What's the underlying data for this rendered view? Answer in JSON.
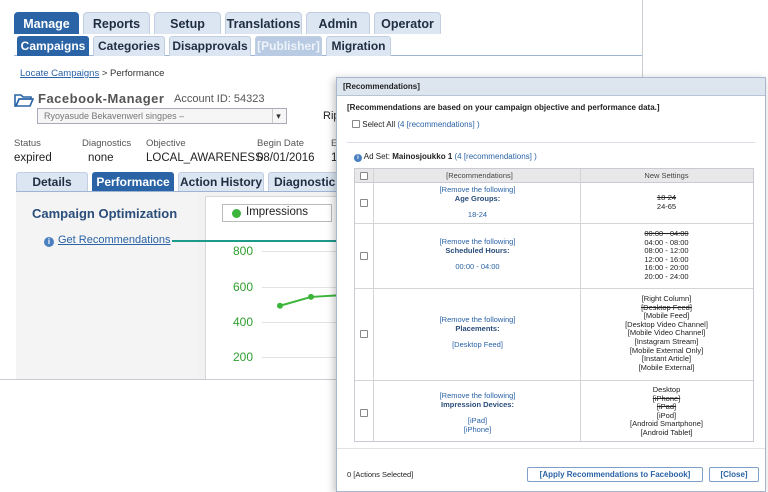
{
  "main_tabs": [
    "Manage",
    "Reports",
    "Setup",
    "Translations",
    "Admin",
    "Operator"
  ],
  "sub_tabs": [
    "Campaigns",
    "Categories",
    "Disapprovals",
    "[Publisher]",
    "Migration"
  ],
  "breadcrumb": {
    "link": "Locate Campaigns",
    "sep": " > ",
    "current": "Performance"
  },
  "account": {
    "name": "Facebook-Manager",
    "id_label": "Account ID: 54323",
    "select_value": "Ryoyasude Bekavenwerl singpes – ",
    "rip": "Rip"
  },
  "info": [
    {
      "label": "Status",
      "value": "expired"
    },
    {
      "label": "Diagnostics",
      "value": "none"
    },
    {
      "label": "Objective",
      "value": "LOCAL_AWARENESS"
    },
    {
      "label": "Begin Date",
      "value": "08/01/2016"
    },
    {
      "label": "E",
      "value": "1"
    }
  ],
  "page_tabs": [
    "Details",
    "Performance",
    "Action History",
    "Diagnostics"
  ],
  "optimization": {
    "title": "Campaign Optimization",
    "link": "Get Recommendations",
    "info_glyph": "i"
  },
  "chart": {
    "legend": "Impressions",
    "ticks": [
      "800",
      "600",
      "400",
      "200"
    ]
  },
  "chart_data": {
    "type": "line",
    "series": [
      {
        "name": "Impressions",
        "values": [
          490,
          540,
          550
        ]
      }
    ],
    "ylim": [
      200,
      800
    ],
    "yticks": [
      "800",
      "600",
      "400",
      "200"
    ],
    "color": "#3db53d"
  },
  "dialog": {
    "title": "[Recommendations]",
    "description": "[Recommendations are based on your campaign objective and performance data.]",
    "select_all": "Select All",
    "select_all_count": "(4 [recommendations] )",
    "adset_prefix": "Ad Set: ",
    "adset_name": "Mainosjoukko 1",
    "adset_count": "(4 [recommendations] )",
    "col_recommendations": "[Recommendations]",
    "col_new_settings": "New Settings",
    "rows": [
      {
        "action": "[Remove the following]",
        "heading": "Age Groups:",
        "items": [
          "18-24"
        ],
        "new_settings": [
          {
            "text": "18-24",
            "strike": true
          },
          {
            "text": "24-65",
            "strike": false
          }
        ]
      },
      {
        "action": "[Remove the following]",
        "heading": "Scheduled Hours:",
        "items": [
          "00:00 - 04:00"
        ],
        "new_settings": [
          {
            "text": "00:00 - 04:00",
            "strike": true
          },
          {
            "text": "04:00 - 08:00",
            "strike": false
          },
          {
            "text": "08:00 - 12:00",
            "strike": false
          },
          {
            "text": "12:00 - 16:00",
            "strike": false
          },
          {
            "text": "16:00 - 20:00",
            "strike": false
          },
          {
            "text": "20:00 - 24:00",
            "strike": false
          }
        ]
      },
      {
        "action": "[Remove the following]",
        "heading": "Placements:",
        "items": [
          "[Desktop Feed]"
        ],
        "new_settings": [
          {
            "text": "[Right Column]",
            "strike": false
          },
          {
            "text": "[Desktop Feed]",
            "strike": true
          },
          {
            "text": "[Mobile Feed]",
            "strike": false
          },
          {
            "text": "[Desktop Video Channel]",
            "strike": false
          },
          {
            "text": "[Mobile Video Channel]",
            "strike": false
          },
          {
            "text": "[Instagram Stream]",
            "strike": false
          },
          {
            "text": "[Mobile External Only]",
            "strike": false
          },
          {
            "text": "[Instant Article]",
            "strike": false
          },
          {
            "text": "[Mobile External]",
            "strike": false
          }
        ]
      },
      {
        "action": "[Remove the following]",
        "heading": "Impression Devices:",
        "items": [
          "[iPad]",
          "[iPhone]"
        ],
        "new_settings": [
          {
            "text": "Desktop",
            "strike": false
          },
          {
            "text": "[iPhone]",
            "strike": true
          },
          {
            "text": "[iPad]",
            "strike": true
          },
          {
            "text": "[iPod]",
            "strike": false
          },
          {
            "text": "[Android Smartphone]",
            "strike": false
          },
          {
            "text": "[Android Tablet]",
            "strike": false
          }
        ]
      }
    ],
    "actions_selected": "0 [Actions Selected]",
    "apply_button": "[Apply Recommendations to Facebook]",
    "close_button": "[Close]"
  },
  "colors": {
    "tab_active": "#2a63a6",
    "tab_inactive": "#dce6f2",
    "link": "#2a63a6",
    "chart_line": "#3db53d",
    "connector": "#1e9a8b"
  }
}
